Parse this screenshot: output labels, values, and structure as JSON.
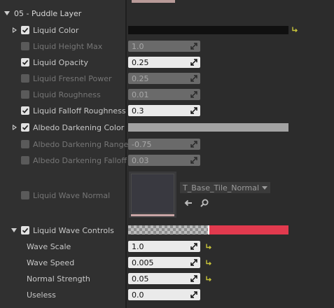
{
  "section": {
    "title": "05 - Puddle Layer"
  },
  "rows": {
    "liquid_color": {
      "label": "Liquid Color",
      "color": "#101010"
    },
    "liquid_height_max": {
      "label": "Liquid Height Max",
      "value": "1.0"
    },
    "liquid_opacity": {
      "label": "Liquid Opacity",
      "value": "0.25"
    },
    "liquid_fresnel_power": {
      "label": "Liquid Fresnel Power",
      "value": "0.25"
    },
    "liquid_roughness": {
      "label": "Liquid Roughness",
      "value": "0.01"
    },
    "liquid_falloff_roughness": {
      "label": "Liquid Falloff Roughness",
      "value": "0.3"
    },
    "albedo_darkening_color": {
      "label": "Albedo Darkening Color",
      "color": "#a3a3a3"
    },
    "albedo_darkening_range": {
      "label": "Albedo Darkening Range",
      "value": "-0.75"
    },
    "albedo_darkening_falloff": {
      "label": "Albedo Darkening Falloff",
      "value": "0.03"
    },
    "liquid_wave_normal": {
      "label": "Liquid Wave Normal",
      "asset": "T_Base_Tile_Normal"
    },
    "liquid_wave_controls": {
      "label": "Liquid Wave Controls"
    },
    "wave_scale": {
      "label": "Wave Scale",
      "value": "1.0"
    },
    "wave_speed": {
      "label": "Wave Speed",
      "value": "0.005"
    },
    "normal_strength": {
      "label": "Normal Strength",
      "value": "0.05"
    },
    "useless": {
      "label": "Useless",
      "value": "0.0"
    }
  },
  "colors": {
    "reset_arrow": "#c8c43a",
    "wave_controls_red": "#e23a4e"
  }
}
